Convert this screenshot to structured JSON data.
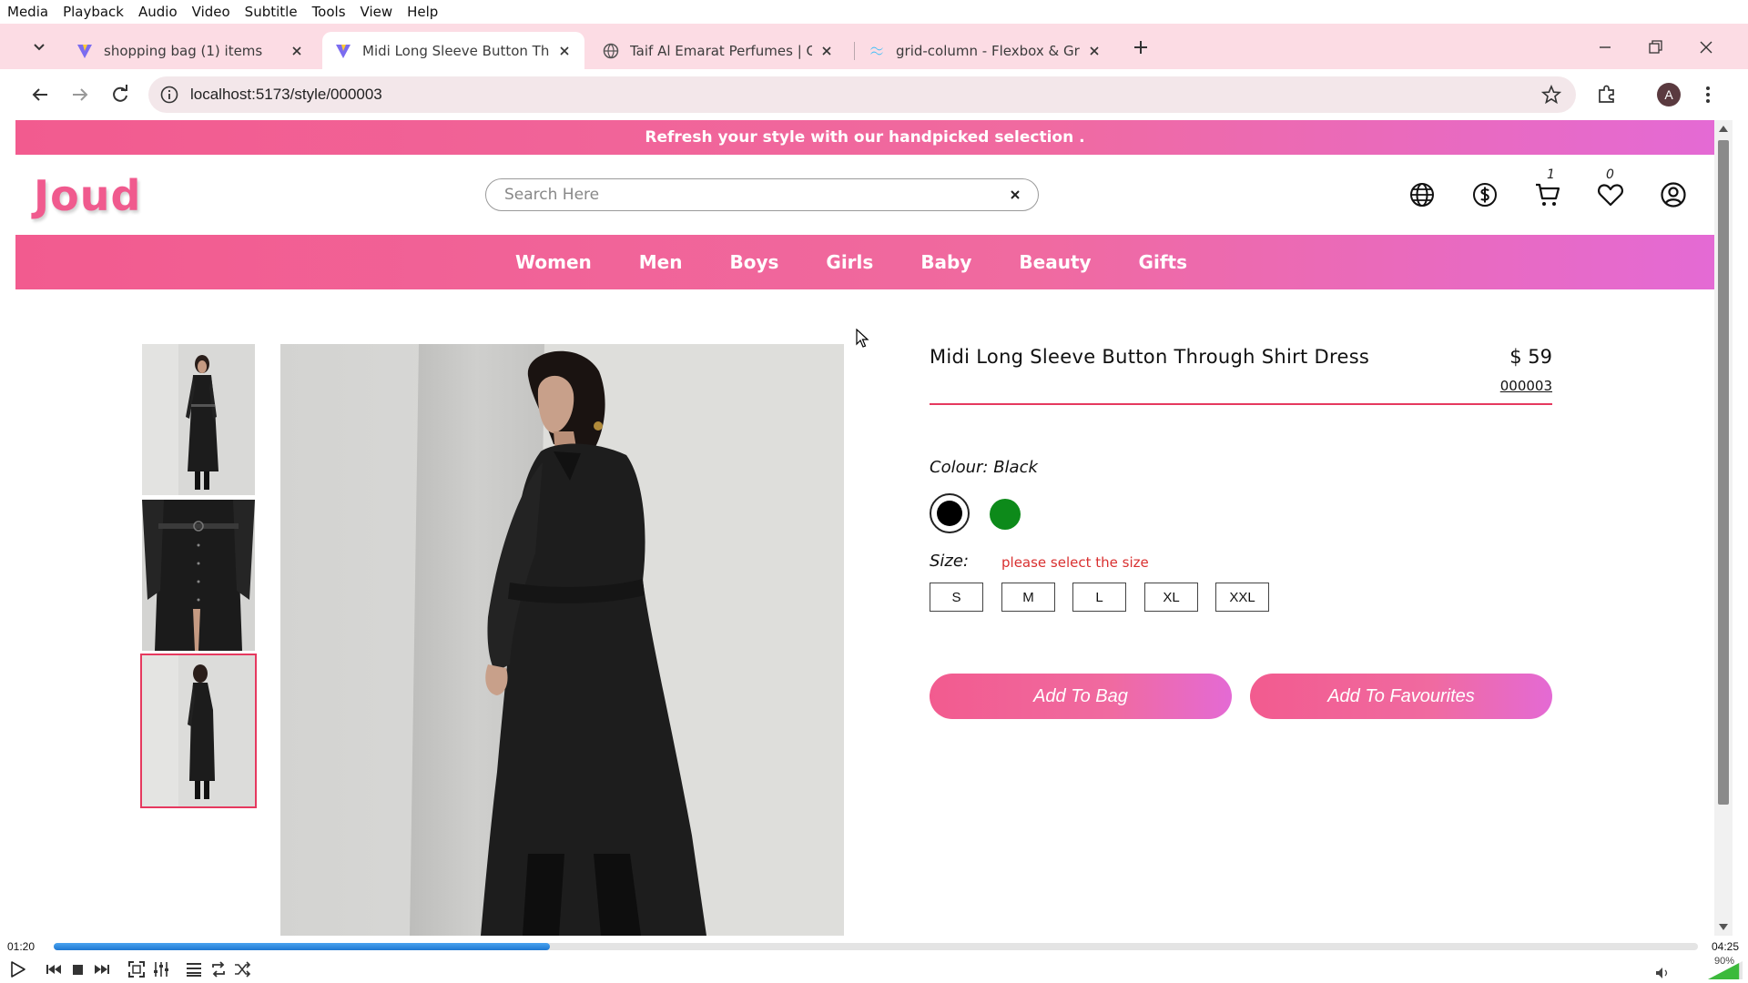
{
  "vlc": {
    "menu": [
      "Media",
      "Playback",
      "Audio",
      "Video",
      "Subtitle",
      "Tools",
      "View",
      "Help"
    ],
    "time_elapsed": "01:20",
    "time_total": "04:25",
    "progress": 0.302,
    "volume": "90%",
    "volume_level": 0.9
  },
  "browser": {
    "tabs": [
      {
        "title": "shopping bag (1) items",
        "favicon": "vite-icon"
      },
      {
        "title": "Midi Long Sleeve Button Throu",
        "favicon": "vite-icon",
        "active": true
      },
      {
        "title": "Taif Al Emarat Perfumes | Contir",
        "favicon": "globe-icon"
      },
      {
        "title": "grid-column - Flexbox & Grid -",
        "favicon": "tailwind-icon"
      }
    ],
    "url": "localhost:5173/style/000003",
    "profile_initial": "A"
  },
  "site": {
    "promo": "Refresh your style with our handpicked selection .",
    "logo": "Joud",
    "search_placeholder": "Search Here",
    "cart_count": "1",
    "favourites_count": "0",
    "categories": [
      "Women",
      "Men",
      "Boys",
      "Girls",
      "Baby",
      "Beauty",
      "Gifts"
    ]
  },
  "product": {
    "title": "Midi Long Sleeve Button Through Shirt Dress",
    "price": "$ 59",
    "code": "000003",
    "colour_label": "Colour:",
    "colour_value": "Black",
    "colours": [
      "#000000",
      "#0d8a1a"
    ],
    "size_label": "Size:",
    "size_error": "please select the size",
    "sizes": [
      "S",
      "M",
      "L",
      "XL",
      "XXL"
    ],
    "add_to_bag": "Add To Bag",
    "add_to_favourites": "Add To Favourites"
  },
  "colors": {
    "accent_pink": "#f05a8e",
    "accent_magenta": "#e46ad4",
    "error_red": "#d93030",
    "tabstrip": "#fcdce4"
  }
}
